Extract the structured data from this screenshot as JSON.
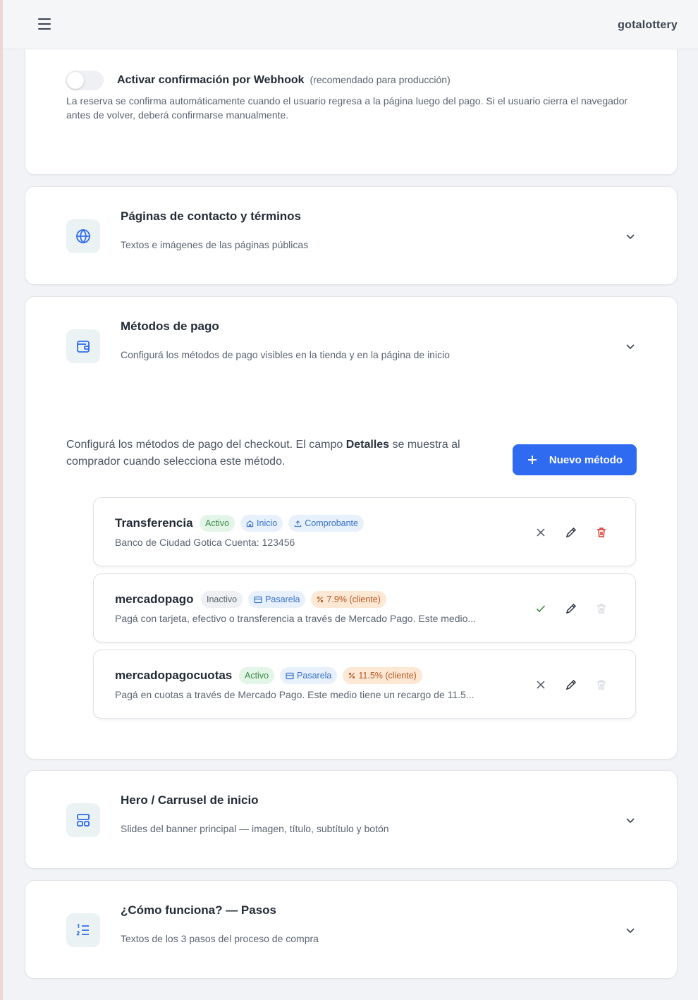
{
  "header": {
    "brand": "gotalottery"
  },
  "webhook": {
    "title": "Activar confirmación por Webhook",
    "note": "(recomendado para producción)",
    "enabled": false,
    "description": "La reserva se confirma automáticamente cuando el usuario regresa a la página luego del pago. Si el usuario cierra el navegador antes de volver, deberá confirmarse manualmente."
  },
  "sections": [
    {
      "title": "Páginas de contacto y términos",
      "subtitle": "Textos e imágenes de las páginas públicas",
      "icon": "globe-icon"
    },
    {
      "title": "Métodos de pago",
      "subtitle": "Configurá los métodos de pago visibles en la tienda y en la página de inicio",
      "icon": "wallet-icon"
    },
    {
      "title": "Hero / Carrusel de inicio",
      "subtitle": "Slides del banner principal — imagen, título, subtítulo y botón",
      "icon": "layout-icon"
    },
    {
      "title": "¿Cómo funciona? — Pasos",
      "subtitle": "Textos de los 3 pasos del proceso de compra",
      "icon": "numbered-list-icon"
    }
  ],
  "payments": {
    "intro_a": "Configurá los métodos de pago del checkout. El campo ",
    "intro_bold": "Detalles",
    "intro_b": " se muestra al comprador cuando selecciona este método.",
    "new_button": "Nuevo método",
    "methods": [
      {
        "name": "Transferencia",
        "status": "Activo",
        "tag1": "Inicio",
        "tag2": "Comprobante",
        "description": "Banco de Ciudad Gotica Cuenta: 123456"
      },
      {
        "name": "mercadopago",
        "status": "Inactivo",
        "tag1": "Pasarela",
        "tag2": "7.9% (cliente)",
        "description": "Pagá con tarjeta, efectivo o transferencia a través de Mercado Pago. Este medio..."
      },
      {
        "name": "mercadopagocuotas",
        "status": "Activo",
        "tag1": "Pasarela",
        "tag2": "11.5% (cliente)",
        "description": "Pagá en cuotas a través de Mercado Pago. Este medio tiene un recargo de 11.5..."
      }
    ]
  },
  "colors": {
    "accent": "#2f6bf0",
    "danger": "#d9362b",
    "success": "#3b8a47"
  }
}
